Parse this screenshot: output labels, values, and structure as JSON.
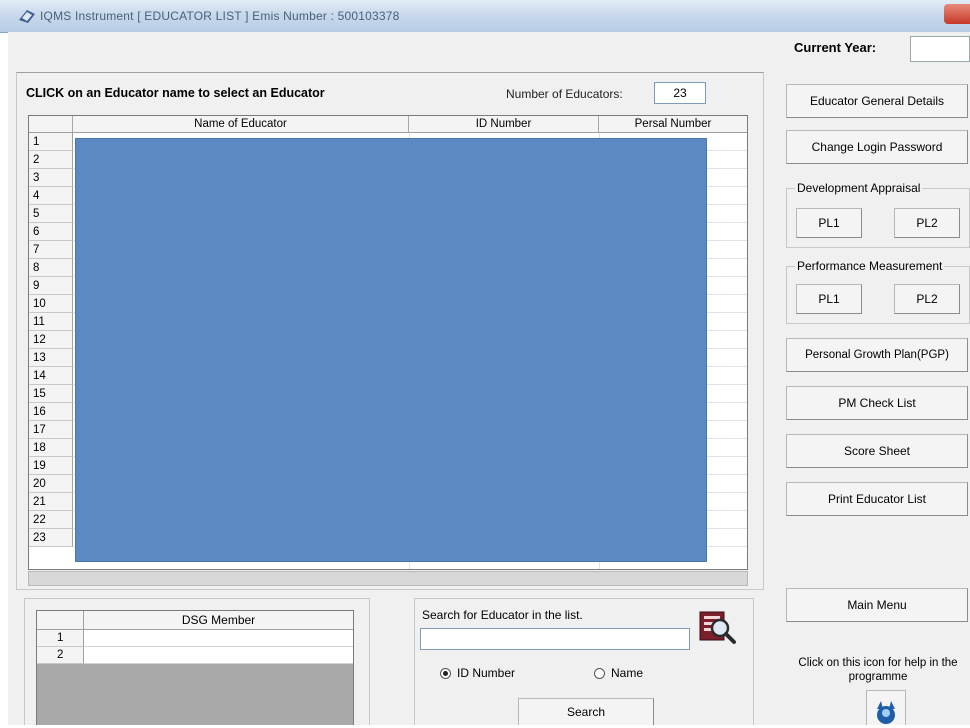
{
  "window": {
    "title": "IQMS Instrument  [ EDUCATOR LIST ]   Emis Number : 500103378"
  },
  "header": {
    "current_year_label": "Current Year:",
    "current_year_value": ""
  },
  "list": {
    "instruction": "CLICK on an Educator name to select an Educator",
    "count_label": "Number of Educators:",
    "count_value": "23",
    "columns": [
      "Name of Educator",
      "ID Number",
      "Persal Number"
    ],
    "row_numbers": [
      "1",
      "2",
      "3",
      "4",
      "5",
      "6",
      "7",
      "8",
      "9",
      "10",
      "11",
      "12",
      "13",
      "14",
      "15",
      "16",
      "17",
      "18",
      "19",
      "20",
      "21",
      "22",
      "23"
    ]
  },
  "sidebar": {
    "general_details": "Educator General Details",
    "change_password": "Change Login Password",
    "development_appraisal": {
      "label": "Development Appraisal",
      "pl1": "PL1",
      "pl2": "PL2"
    },
    "performance_measurement": {
      "label": "Performance Measurement",
      "pl1": "PL1",
      "pl2": "PL2"
    },
    "personal_growth_plan": "Personal Growth Plan(PGP)",
    "pm_check_list": "PM Check List",
    "score_sheet": "Score Sheet",
    "print_educator_list": "Print Educator List",
    "main_menu": "Main Menu",
    "help_text": "Click on this icon for help in the programme"
  },
  "dsg": {
    "column": "DSG Member",
    "row_numbers": [
      "1",
      "2"
    ]
  },
  "search": {
    "label": "Search for Educator in the list.",
    "value": "",
    "option_id": "ID Number",
    "option_name": "Name",
    "selected": "ID Number",
    "button": "Search"
  },
  "colors": {
    "mask": "#5b8ac3",
    "titlebar": "#c9d9ec"
  }
}
